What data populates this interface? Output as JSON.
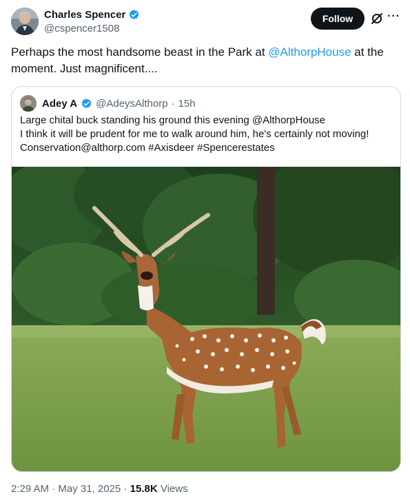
{
  "author": {
    "display_name": "Charles Spencer",
    "handle": "@cspencer1508",
    "verified_icon": "verified-badge-icon"
  },
  "actions": {
    "follow_label": "Follow",
    "grok_icon": "grok-icon",
    "more_label": "···"
  },
  "tweet": {
    "text_before": "Perhaps the most handsome beast in the Park at ",
    "mention": "@AlthorpHouse",
    "text_after": " at the moment. Just magnificent...."
  },
  "quote": {
    "display_name": "Adey A",
    "handle": "@AdeysAlthorp",
    "separator": "·",
    "time": "15h",
    "lines": [
      "Large chital buck standing his ground this evening @AlthorpHouse",
      "I think it will be prudent for me to walk around him, he's certainly not moving!",
      "Conservation@althorp.com #Axisdeer #Spencerestates"
    ],
    "image_subject": "chital-buck-photo"
  },
  "footer": {
    "time": "2:29 AM",
    "sep1": " · ",
    "date": "May 31, 2025",
    "sep2": " · ",
    "views_count": "15.8K",
    "views_label": " Views"
  },
  "colors": {
    "link": "#1d9bf0",
    "verified": "#1d9bf0",
    "text": "#0f1419",
    "muted": "#536471",
    "border": "#cfd9de"
  }
}
